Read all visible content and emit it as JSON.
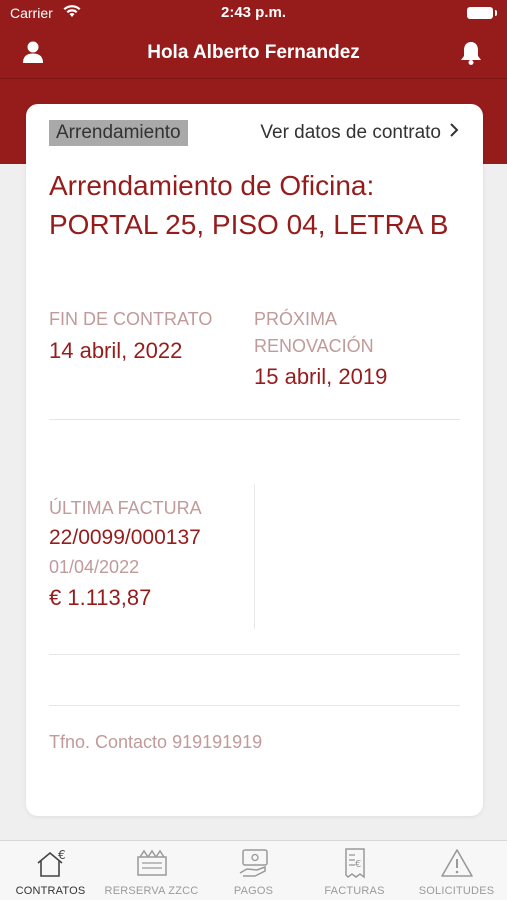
{
  "status": {
    "carrier": "Carrier",
    "time": "2:43 p.m."
  },
  "header": {
    "title": "Hola Alberto Fernandez"
  },
  "card": {
    "tag": "Arrendamiento",
    "view_link": "Ver datos de contrato",
    "title": "Arrendamiento de Oficina: PORTAL 25, PISO 04, LETRA B",
    "end_label": "FIN DE CONTRATO",
    "end_value": "14 abril, 2022",
    "renewal_label": "PRÓXIMA RENOVACIÓN",
    "renewal_value": "15 abril, 2019",
    "invoice_label": "ÚLTIMA FACTURA",
    "invoice_number": "22/0099/000137",
    "invoice_date": "01/04/2022",
    "invoice_amount": "€ 1.113,87",
    "contact": "Tfno. Contacto 919191919"
  },
  "tabs": [
    {
      "label": "CONTRATOS",
      "icon": "house-euro-icon",
      "active": true
    },
    {
      "label": "RERSERVA ZZCC",
      "icon": "reservation-icon",
      "active": false
    },
    {
      "label": "PAGOS",
      "icon": "payment-hand-icon",
      "active": false
    },
    {
      "label": "FACTURAS",
      "icon": "invoice-icon",
      "active": false
    },
    {
      "label": "SOLICITUDES",
      "icon": "warning-icon",
      "active": false
    }
  ],
  "colors": {
    "brand": "#961c1c",
    "label": "#c19a9a",
    "background": "#f0efef"
  }
}
